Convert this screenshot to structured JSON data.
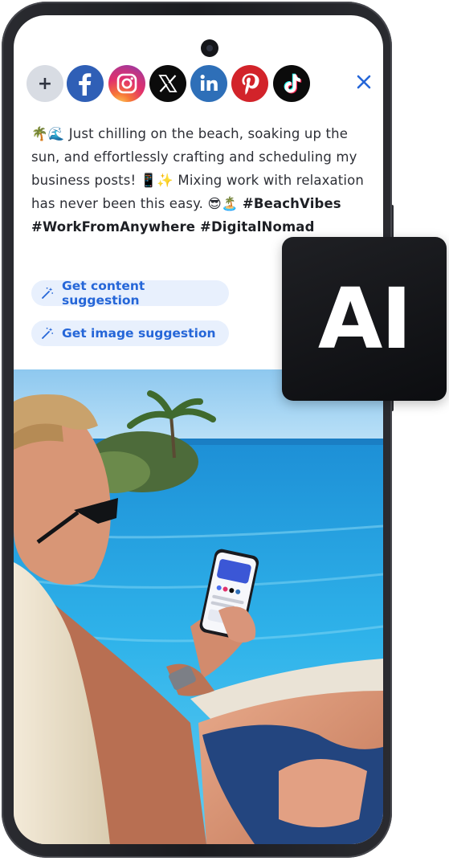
{
  "toolbar": {
    "add_label": "+",
    "networks": [
      {
        "name": "facebook-icon",
        "color": "#2f5fb6"
      },
      {
        "name": "instagram-icon",
        "color": "#e1306c"
      },
      {
        "name": "x-icon",
        "color": "#0b0b0b"
      },
      {
        "name": "linkedin-icon",
        "color": "#2e6fb8"
      },
      {
        "name": "pinterest-icon",
        "color": "#d2232a"
      },
      {
        "name": "tiktok-icon",
        "color": "#0b0b0b"
      }
    ],
    "close_icon": "close-icon",
    "accent_color": "#2566d8"
  },
  "post": {
    "text_part1": "🌴🌊 Just chilling on the beach, soaking up the sun, and effortlessly crafting and scheduling my business posts! 📱✨ Mixing work with relaxation has never been this easy. 😎🏝️ ",
    "hashtags": "#BeachVibes #WorkFromAnywhere #DigitalNomad"
  },
  "suggestions": {
    "content_label": "Get content suggestion",
    "image_label": "Get image suggestion"
  },
  "badge": {
    "label": "AI"
  }
}
